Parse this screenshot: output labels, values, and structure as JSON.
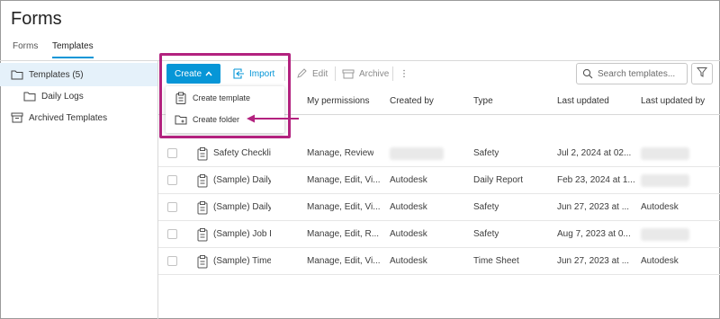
{
  "page": {
    "title": "Forms"
  },
  "tabs": [
    {
      "label": "Forms",
      "active": false
    },
    {
      "label": "Templates",
      "active": true
    }
  ],
  "sidebar": {
    "items": [
      {
        "label": "Templates (5)",
        "icon": "folder-icon",
        "selected": true
      },
      {
        "label": "Daily Logs",
        "icon": "folder-icon",
        "selected": false
      },
      {
        "label": "Archived Templates",
        "icon": "archive-icon",
        "selected": false
      }
    ]
  },
  "toolbar": {
    "create_label": "Create",
    "import_label": "Import",
    "edit_label": "Edit",
    "archive_label": "Archive",
    "more_label": "⋮",
    "search_placeholder": "Search templates..."
  },
  "dropdown": {
    "items": [
      {
        "label": "Create template",
        "icon": "clipboard-icon"
      },
      {
        "label": "Create folder",
        "icon": "folder-plus-icon"
      }
    ]
  },
  "table": {
    "columns": [
      "My permissions",
      "Created by",
      "Type",
      "Last updated",
      "Last updated by"
    ],
    "rows": [
      {
        "name": "Safety Checklist",
        "permissions": "Manage, Review",
        "created_by": "",
        "type": "Safety",
        "last_updated": "Jul 2, 2024 at 02...",
        "last_updated_by": ""
      },
      {
        "name": "(Sample) Daily",
        "permissions": "Manage, Edit, Vi...",
        "created_by": "Autodesk",
        "type": "Daily Report",
        "last_updated": "Feb 23, 2024 at 1...",
        "last_updated_by": ""
      },
      {
        "name": "(Sample) Daily S",
        "permissions": "Manage, Edit, Vi...",
        "created_by": "Autodesk",
        "type": "Safety",
        "last_updated": "Jun 27, 2023 at ...",
        "last_updated_by": "Autodesk"
      },
      {
        "name": "(Sample) Job H",
        "permissions": "Manage, Edit, R...",
        "created_by": "Autodesk",
        "type": "Safety",
        "last_updated": "Aug 7, 2023 at 0...",
        "last_updated_by": ""
      },
      {
        "name": "(Sample) Time S",
        "permissions": "Manage, Edit, Vi...",
        "created_by": "Autodesk",
        "type": "Time Sheet",
        "last_updated": "Jun 27, 2023 at ...",
        "last_updated_by": "Autodesk"
      }
    ]
  },
  "colors": {
    "accent": "#0696d7",
    "highlight": "#b3227f",
    "selected_bg": "#e5f1fa"
  }
}
